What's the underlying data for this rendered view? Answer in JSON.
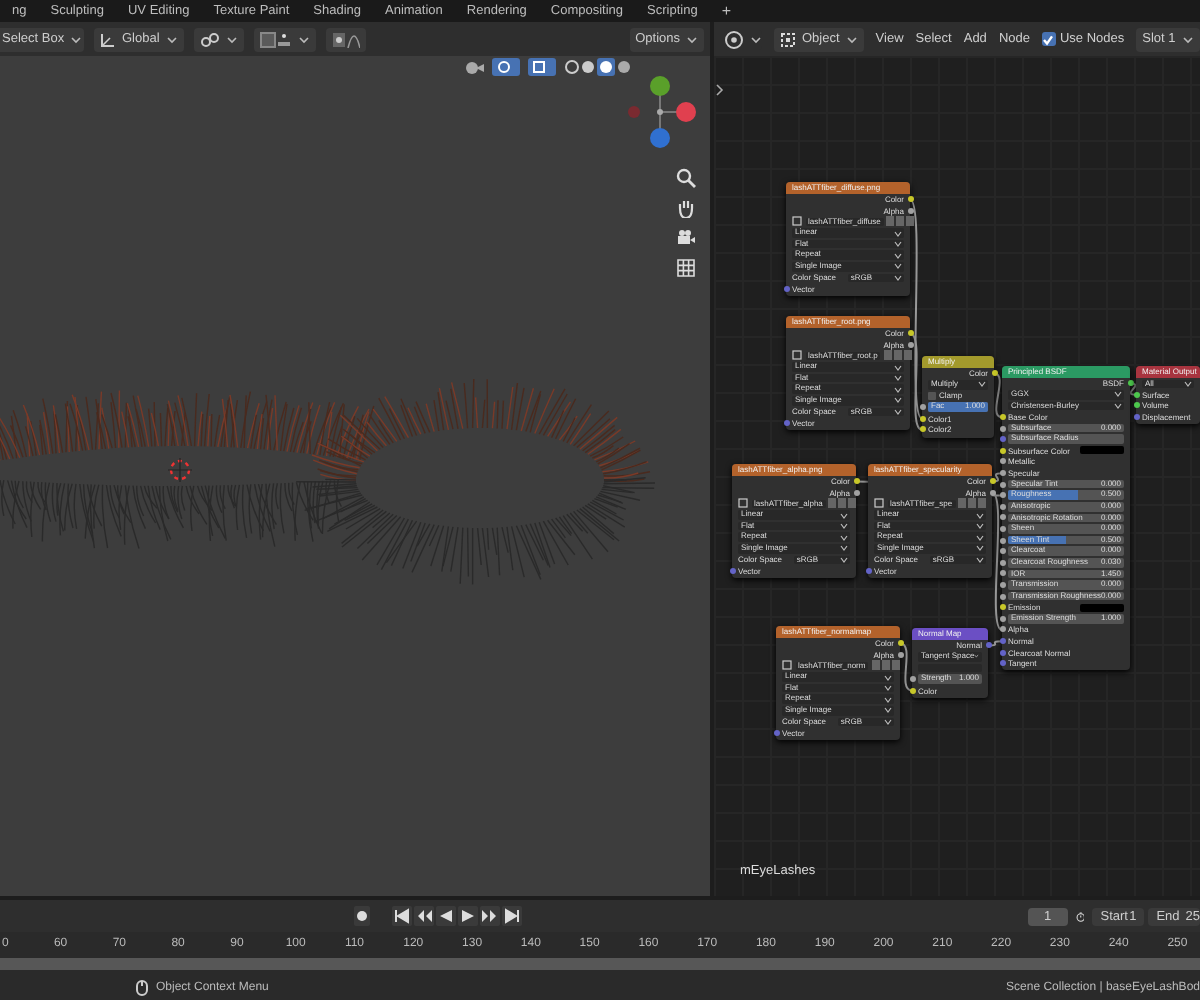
{
  "workspace_tabs": [
    {
      "label": "ng"
    },
    {
      "label": "Sculpting"
    },
    {
      "label": "UV Editing"
    },
    {
      "label": "Texture Paint"
    },
    {
      "label": "Shading"
    },
    {
      "label": "Animation"
    },
    {
      "label": "Rendering"
    },
    {
      "label": "Compositing"
    },
    {
      "label": "Scripting"
    }
  ],
  "add_tab": "+",
  "viewport": {
    "select_mode": "Select Box",
    "orientation": "Global",
    "options": "Options"
  },
  "node_editor": {
    "object_mode": "Object",
    "menus": [
      "View",
      "Select",
      "Add",
      "Node"
    ],
    "use_nodes": {
      "label": "Use Nodes",
      "checked": true
    },
    "slot": "Slot 1",
    "material_label": "mEyeLashes",
    "nodes": [
      {
        "title": "lashATTfiber_diffuse.png",
        "color": "#b3622b",
        "rows": [
          {
            "kind": "output",
            "label": "Color",
            "socket": {
              "color": "#c7c729"
            }
          },
          {
            "kind": "output",
            "label": "Alpha",
            "socket": {
              "color": "#a1a1a1"
            }
          },
          {
            "kind": "image",
            "label": "lashATTfiber_diffuse"
          },
          {
            "kind": "dropdown",
            "label": "Linear"
          },
          {
            "kind": "dropdown",
            "label": "Flat"
          },
          {
            "kind": "dropdown",
            "label": "Repeat"
          },
          {
            "kind": "dropdown",
            "label": "Single Image"
          },
          {
            "kind": "prop",
            "label": "Color Space",
            "value": "sRGB"
          },
          {
            "kind": "input",
            "label": "Vector",
            "socket": {
              "color": "#6363c7"
            }
          }
        ]
      },
      {
        "title": "lashATTfiber_root.png",
        "color": "#b3622b",
        "rows": [
          {
            "kind": "output",
            "label": "Color",
            "socket": {
              "color": "#c7c729"
            }
          },
          {
            "kind": "output",
            "label": "Alpha",
            "socket": {
              "color": "#a1a1a1"
            }
          },
          {
            "kind": "image",
            "label": "lashATTfiber_root.p"
          },
          {
            "kind": "dropdown",
            "label": "Linear"
          },
          {
            "kind": "dropdown",
            "label": "Flat"
          },
          {
            "kind": "dropdown",
            "label": "Repeat"
          },
          {
            "kind": "dropdown",
            "label": "Single Image"
          },
          {
            "kind": "prop",
            "label": "Color Space",
            "value": "sRGB"
          },
          {
            "kind": "input",
            "label": "Vector",
            "socket": {
              "color": "#6363c7"
            }
          }
        ]
      },
      {
        "title": "Multiply",
        "color": "#a39a2c",
        "rows": [
          {
            "kind": "output",
            "label": "Color",
            "socket": {
              "color": "#c7c729"
            }
          },
          {
            "kind": "dropdown",
            "label": "Multiply"
          },
          {
            "kind": "checkbox",
            "label": "Clamp",
            "checked": false
          },
          {
            "kind": "slider",
            "label": "Fac",
            "value": "1.000",
            "level": 1,
            "socket": {
              "color": "#a1a1a1"
            }
          },
          {
            "kind": "input",
            "label": "Color1",
            "socket": {
              "color": "#c7c729"
            }
          },
          {
            "kind": "input",
            "label": "Color2",
            "socket": {
              "color": "#c7c729"
            }
          }
        ]
      },
      {
        "title": "Principled BSDF",
        "color": "#2b9a63",
        "rows": [
          {
            "kind": "output",
            "label": "BSDF",
            "socket": {
              "color": "#4dc74d"
            }
          },
          {
            "kind": "dropdown",
            "label": "GGX"
          },
          {
            "kind": "dropdown",
            "label": "Christensen-Burley"
          },
          {
            "kind": "input",
            "label": "Base Color",
            "socket": {
              "color": "#c7c729"
            }
          },
          {
            "kind": "field",
            "label": "Subsurface",
            "value": "0.000",
            "socket": {
              "color": "#a1a1a1"
            }
          },
          {
            "kind": "field",
            "label": "Subsurface Radius",
            "socket": {
              "color": "#6363c7"
            }
          },
          {
            "kind": "swatch",
            "label": "Subsurface Color",
            "color": "#000000",
            "socket": {
              "color": "#c7c729"
            }
          },
          {
            "kind": "input",
            "label": "Metallic",
            "socket": {
              "color": "#a1a1a1"
            }
          },
          {
            "kind": "input",
            "label": "Specular",
            "socket": {
              "color": "#a1a1a1"
            }
          },
          {
            "kind": "field",
            "label": "Specular Tint",
            "value": "0.000",
            "socket": {
              "color": "#a1a1a1"
            }
          },
          {
            "kind": "slider",
            "label": "Roughness",
            "value": "0.500",
            "level": 0.6,
            "socket": {
              "color": "#a1a1a1"
            }
          },
          {
            "kind": "field",
            "label": "Anisotropic",
            "value": "0.000",
            "socket": {
              "color": "#a1a1a1"
            }
          },
          {
            "kind": "field",
            "label": "Anisotropic Rotation",
            "value": "0.000",
            "socket": {
              "color": "#a1a1a1"
            }
          },
          {
            "kind": "field",
            "label": "Sheen",
            "value": "0.000",
            "socket": {
              "color": "#a1a1a1"
            }
          },
          {
            "kind": "slider",
            "label": "Sheen Tint",
            "value": "0.500",
            "level": 0.5,
            "socket": {
              "color": "#a1a1a1"
            }
          },
          {
            "kind": "field",
            "label": "Clearcoat",
            "value": "0.000",
            "socket": {
              "color": "#a1a1a1"
            }
          },
          {
            "kind": "field",
            "label": "Clearcoat Roughness",
            "value": "0.030",
            "socket": {
              "color": "#a1a1a1"
            }
          },
          {
            "kind": "field",
            "label": "IOR",
            "value": "1.450",
            "socket": {
              "color": "#a1a1a1"
            }
          },
          {
            "kind": "field",
            "label": "Transmission",
            "value": "0.000",
            "socket": {
              "color": "#a1a1a1"
            }
          },
          {
            "kind": "field",
            "label": "Transmission Roughness",
            "value": "0.000",
            "socket": {
              "color": "#a1a1a1"
            }
          },
          {
            "kind": "swatch",
            "label": "Emission",
            "color": "#000000",
            "socket": {
              "color": "#c7c729"
            }
          },
          {
            "kind": "field",
            "label": "Emission Strength",
            "value": "1.000",
            "socket": {
              "color": "#a1a1a1"
            }
          },
          {
            "kind": "input",
            "label": "Alpha",
            "socket": {
              "color": "#a1a1a1"
            }
          },
          {
            "kind": "input",
            "label": "Normal",
            "socket": {
              "color": "#6363c7"
            }
          },
          {
            "kind": "input",
            "label": "Clearcoat Normal",
            "socket": {
              "color": "#6363c7"
            }
          },
          {
            "kind": "input",
            "label": "Tangent",
            "socket": {
              "color": "#6363c7"
            }
          }
        ]
      },
      {
        "title": "Material Output",
        "color": "#a8343f",
        "rows": [
          {
            "kind": "dropdown",
            "label": "All"
          },
          {
            "kind": "input",
            "label": "Surface",
            "socket": {
              "color": "#4dc74d"
            }
          },
          {
            "kind": "input",
            "label": "Volume",
            "socket": {
              "color": "#4dc74d"
            }
          },
          {
            "kind": "input",
            "label": "Displacement",
            "socket": {
              "color": "#6363c7"
            }
          }
        ]
      },
      {
        "title": "lashATTfiber_alpha.png",
        "color": "#b3622b",
        "rows": [
          {
            "kind": "output",
            "label": "Color",
            "socket": {
              "color": "#c7c729"
            }
          },
          {
            "kind": "output",
            "label": "Alpha",
            "socket": {
              "color": "#a1a1a1"
            }
          },
          {
            "kind": "image",
            "label": "lashATTfiber_alpha"
          },
          {
            "kind": "dropdown",
            "label": "Linear"
          },
          {
            "kind": "dropdown",
            "label": "Flat"
          },
          {
            "kind": "dropdown",
            "label": "Repeat"
          },
          {
            "kind": "dropdown",
            "label": "Single Image"
          },
          {
            "kind": "prop",
            "label": "Color Space",
            "value": "sRGB"
          },
          {
            "kind": "input",
            "label": "Vector",
            "socket": {
              "color": "#6363c7"
            }
          }
        ]
      },
      {
        "title": "lashATTfiber_specularity",
        "color": "#b3622b",
        "rows": [
          {
            "kind": "output",
            "label": "Color",
            "socket": {
              "color": "#c7c729"
            }
          },
          {
            "kind": "output",
            "label": "Alpha",
            "socket": {
              "color": "#a1a1a1"
            }
          },
          {
            "kind": "image",
            "label": "lashATTfiber_spe"
          },
          {
            "kind": "dropdown",
            "label": "Linear"
          },
          {
            "kind": "dropdown",
            "label": "Flat"
          },
          {
            "kind": "dropdown",
            "label": "Repeat"
          },
          {
            "kind": "dropdown",
            "label": "Single Image"
          },
          {
            "kind": "prop",
            "label": "Color Space",
            "value": "sRGB"
          },
          {
            "kind": "input",
            "label": "Vector",
            "socket": {
              "color": "#6363c7"
            }
          }
        ]
      },
      {
        "title": "lashATTfiber_normalmap",
        "color": "#b3622b",
        "rows": [
          {
            "kind": "output",
            "label": "Color",
            "socket": {
              "color": "#c7c729"
            }
          },
          {
            "kind": "output",
            "label": "Alpha",
            "socket": {
              "color": "#a1a1a1"
            }
          },
          {
            "kind": "image",
            "label": "lashATTfiber_norm"
          },
          {
            "kind": "dropdown",
            "label": "Linear"
          },
          {
            "kind": "dropdown",
            "label": "Flat"
          },
          {
            "kind": "dropdown",
            "label": "Repeat"
          },
          {
            "kind": "dropdown",
            "label": "Single Image"
          },
          {
            "kind": "prop",
            "label": "Color Space",
            "value": "sRGB"
          },
          {
            "kind": "input",
            "label": "Vector",
            "socket": {
              "color": "#6363c7"
            }
          }
        ]
      },
      {
        "title": "Normal Map",
        "color": "#6b4fc4",
        "rows": [
          {
            "kind": "output",
            "label": "Normal",
            "socket": {
              "color": "#6363c7"
            }
          },
          {
            "kind": "dropdown",
            "label": "Tangent Space"
          },
          {
            "kind": "blank"
          },
          {
            "kind": "field",
            "label": "Strength",
            "value": "1.000",
            "socket": {
              "color": "#a1a1a1"
            }
          },
          {
            "kind": "input",
            "label": "Color",
            "socket": {
              "color": "#c7c729"
            }
          }
        ]
      }
    ]
  },
  "timeline": {
    "current_frame": "1",
    "start_label": "Start",
    "start": "1",
    "end_label": "End",
    "end": "25",
    "ticks": [
      "0",
      "60",
      "70",
      "80",
      "90",
      "100",
      "110",
      "120",
      "130",
      "140",
      "150",
      "160",
      "170",
      "180",
      "190",
      "200",
      "210",
      "220",
      "230",
      "240",
      "250"
    ]
  },
  "status_bar": {
    "hint": "Object Context Menu",
    "info": "Scene Collection | baseEyeLashBod"
  }
}
